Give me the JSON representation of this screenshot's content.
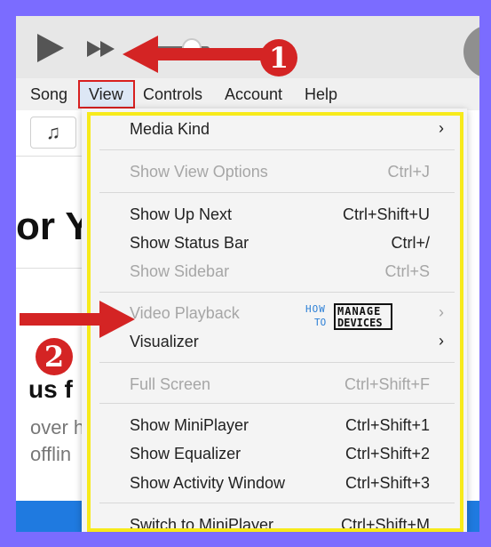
{
  "menubar": {
    "items": [
      {
        "label": "Song"
      },
      {
        "label": "View"
      },
      {
        "label": "Controls"
      },
      {
        "label": "Account"
      },
      {
        "label": "Help"
      }
    ]
  },
  "view_menu": {
    "items": [
      {
        "label": "Media Kind",
        "shortcut": "",
        "submenu": true,
        "enabled": true
      },
      {
        "label": "Show View Options",
        "shortcut": "Ctrl+J",
        "submenu": false,
        "enabled": false
      },
      {
        "label": "Show Up Next",
        "shortcut": "Ctrl+Shift+U",
        "submenu": false,
        "enabled": true
      },
      {
        "label": "Show Status Bar",
        "shortcut": "Ctrl+/",
        "submenu": false,
        "enabled": true
      },
      {
        "label": "Show Sidebar",
        "shortcut": "Ctrl+S",
        "submenu": false,
        "enabled": false
      },
      {
        "label": "Video Playback",
        "shortcut": "",
        "submenu": true,
        "enabled": false
      },
      {
        "label": "Visualizer",
        "shortcut": "",
        "submenu": true,
        "enabled": true
      },
      {
        "label": "Full Screen",
        "shortcut": "Ctrl+Shift+F",
        "submenu": false,
        "enabled": false
      },
      {
        "label": "Show MiniPlayer",
        "shortcut": "Ctrl+Shift+1",
        "submenu": false,
        "enabled": true
      },
      {
        "label": "Show Equalizer",
        "shortcut": "Ctrl+Shift+2",
        "submenu": false,
        "enabled": true
      },
      {
        "label": "Show Activity Window",
        "shortcut": "Ctrl+Shift+3",
        "submenu": false,
        "enabled": true
      },
      {
        "label": "Switch to MiniPlayer",
        "shortcut": "Ctrl+Shift+M",
        "submenu": false,
        "enabled": true
      }
    ]
  },
  "background": {
    "heading_fragment": "or Y",
    "subheading_fragment": "us f",
    "body_line_1": "over h",
    "body_line_2": "offlin"
  },
  "watermark": {
    "how": "HOW",
    "to": "TO",
    "manage": "MANAGE",
    "devices": "DEVICES"
  },
  "annotations": {
    "step1": "1",
    "step2": "2"
  },
  "icons": {
    "play": "play-icon",
    "fast_forward": "fast-forward-icon",
    "music_note": "music-note-icon",
    "submenu": "chevron-right-icon"
  },
  "colors": {
    "annotation_red": "#d42424",
    "highlight_yellow": "#f7ea1a",
    "page_border": "#7b6cff",
    "blue_bar": "#1f7ae0"
  }
}
